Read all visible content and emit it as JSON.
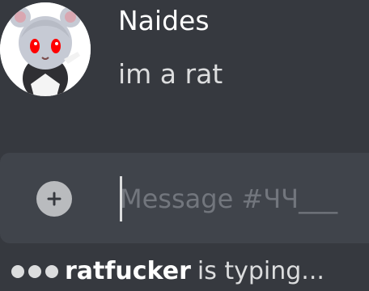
{
  "message": {
    "author": "Naides",
    "content": "im a rat",
    "avatar_icon": "avatar-icon"
  },
  "composer": {
    "add_icon": "plus-circle-icon",
    "placeholder": "Message #ЧЧ___"
  },
  "typing_indicator": {
    "user": "ratfucker",
    "suffix": "is typing..."
  },
  "colors": {
    "background": "#36393f",
    "input_background": "#40444b",
    "text": "#dcddde",
    "muted": "#72767d"
  }
}
